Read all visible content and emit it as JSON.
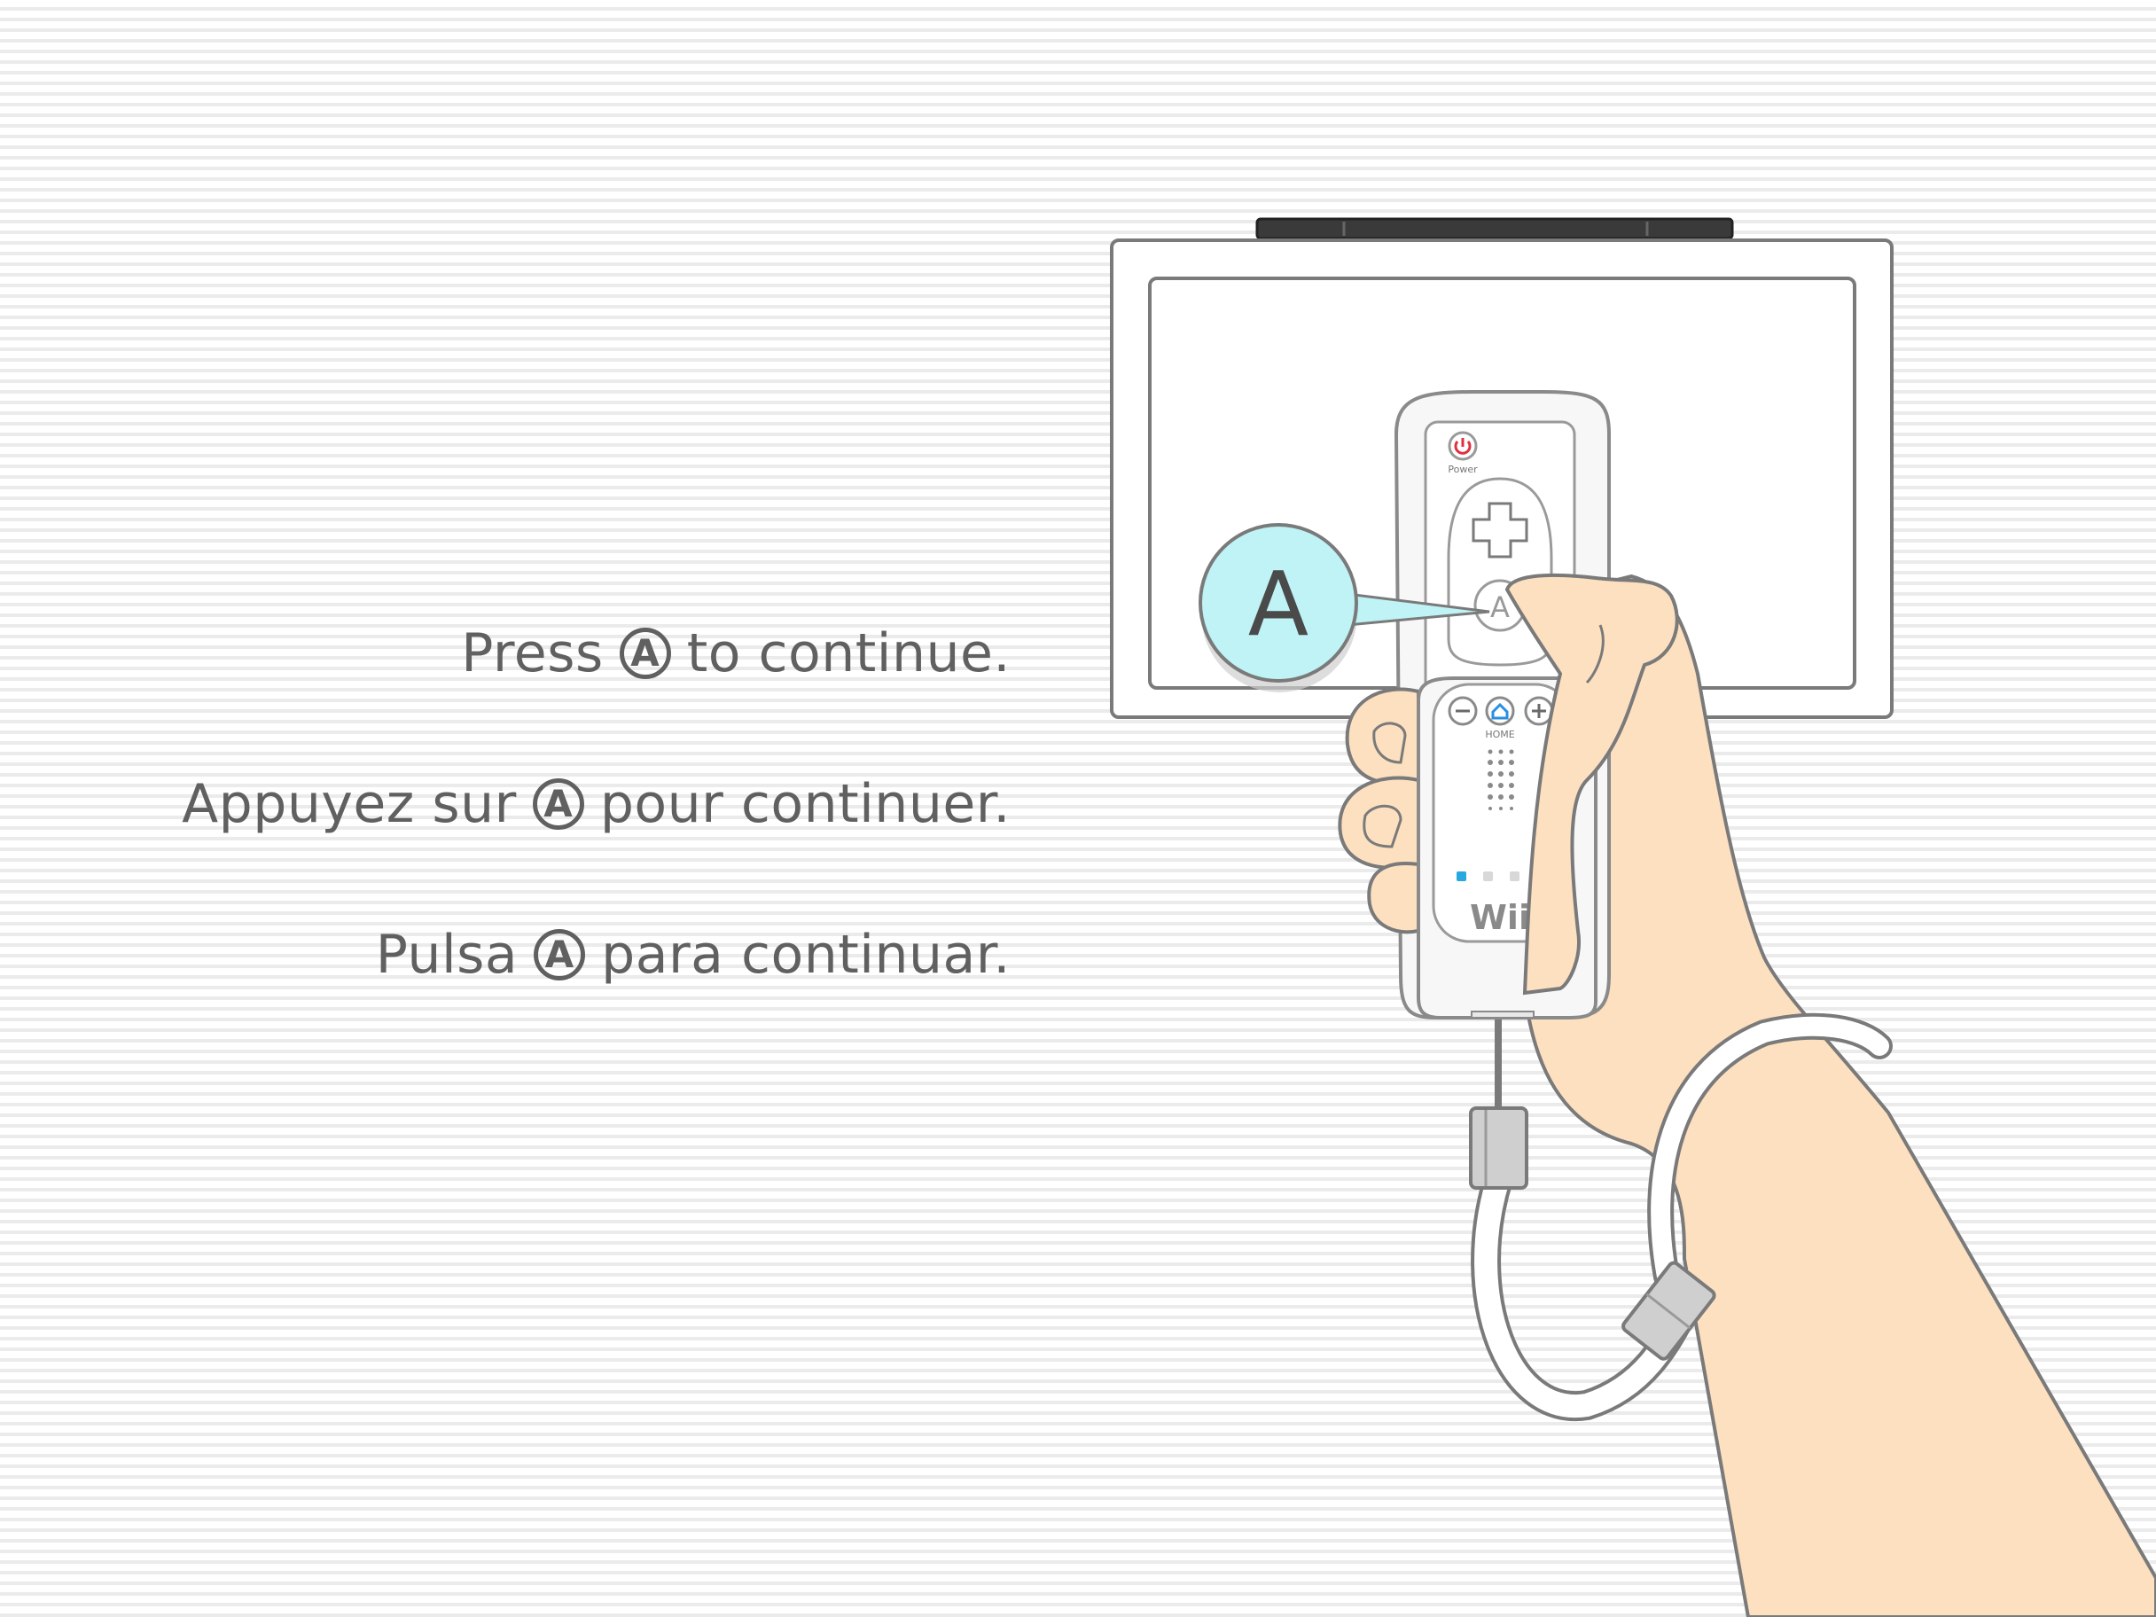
{
  "instructions": {
    "en": {
      "before": "Press",
      "button": "A",
      "after": "to continue."
    },
    "fr": {
      "before": "Appuyez sur",
      "button": "A",
      "after": "pour continuer."
    },
    "es": {
      "before": "Pulsa",
      "button": "A",
      "after": "para continuar."
    }
  },
  "remote": {
    "callout_label": "A",
    "power_label": "Power",
    "home_label": "HOME",
    "brand_label": "Wii",
    "a_button_label": "A",
    "player_leds": 4,
    "active_player_led": 1
  },
  "colors": {
    "background": "#f7f7f7",
    "text": "#606060",
    "skin": "#fde0c0",
    "callout": "#bff3f6",
    "led_active": "#29a8e0",
    "power_button": "#e03040",
    "home_button": "#2a8fe0",
    "sensor_bar": "#3a3a3a"
  }
}
